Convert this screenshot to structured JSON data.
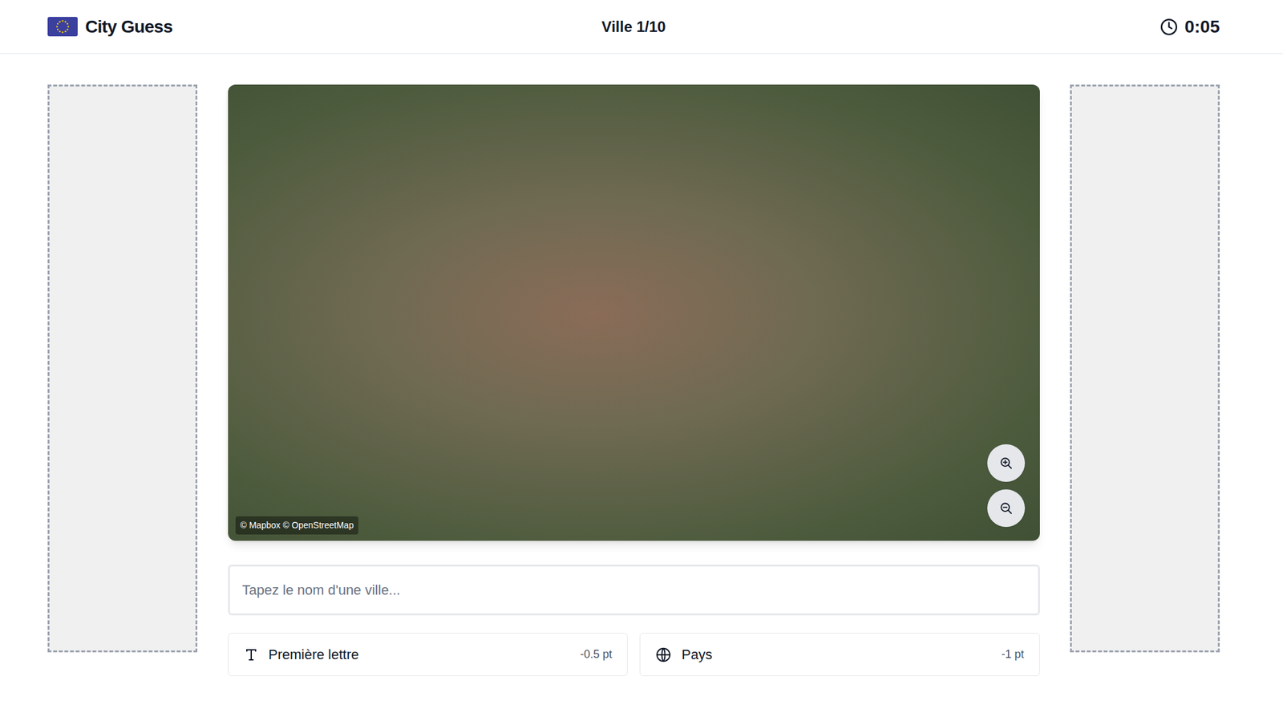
{
  "header": {
    "title": "City Guess",
    "progress": "Ville 1/10",
    "timer": "0:05"
  },
  "map": {
    "attribution": "© Mapbox © OpenStreetMap"
  },
  "search": {
    "placeholder": "Tapez le nom d'une ville..."
  },
  "hints": [
    {
      "label": "Première lettre",
      "cost": "-0.5 pt"
    },
    {
      "label": "Pays",
      "cost": "-1 pt"
    }
  ]
}
